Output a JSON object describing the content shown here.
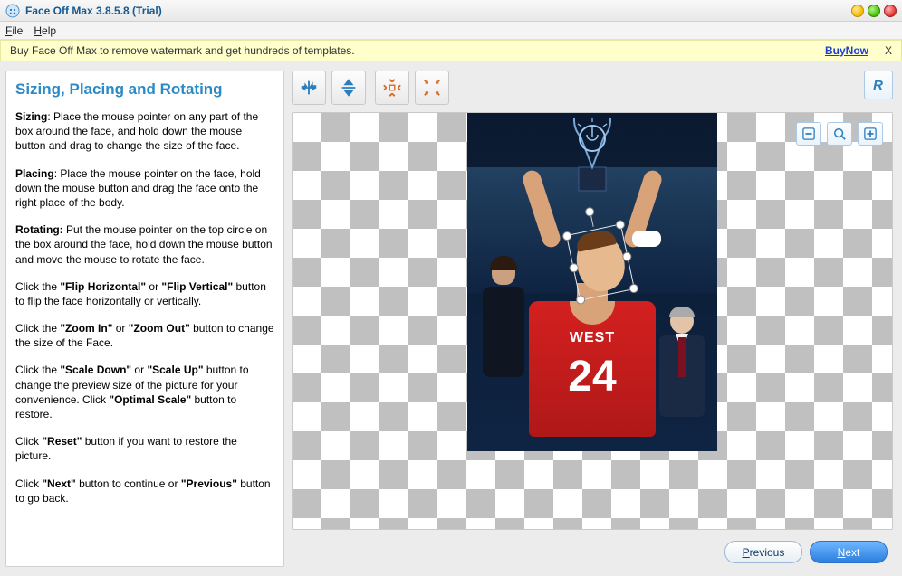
{
  "window": {
    "title": "Face Off Max  3.8.5.8  (Trial)"
  },
  "menu": {
    "file": "File",
    "help": "Help"
  },
  "trial": {
    "message": "Buy Face Off Max to remove watermark and get hundreds of templates.",
    "buy_label": "BuyNow",
    "close_label": "X"
  },
  "help_panel": {
    "title": "Sizing, Placing and Rotating",
    "sizing_label": "Sizing",
    "sizing_text": ": Place the mouse pointer on any part of the box around the face, and hold down the mouse button and drag to change the size of the face.",
    "placing_label": "Placing",
    "placing_text": ": Place the mouse pointer on the face, hold down the mouse button and drag the face onto the right place of the body.",
    "rotating_label": "Rotating:",
    "rotating_text": " Put the mouse pointer on the top circle on the box around the face, hold down the mouse button and move the mouse to rotate the face.",
    "flip_pre": "Click the ",
    "flip_h": "\"Flip Horizontal\"",
    "flip_or": " or ",
    "flip_v": "\"Flip Vertical\"",
    "flip_post": " button to flip the face horizontally or vertically.",
    "zoom_pre": "Click the ",
    "zoom_in": "\"Zoom In\"",
    "zoom_or": " or ",
    "zoom_out": "\"Zoom Out\"",
    "zoom_post": " button to change the size of the Face.",
    "scale_pre": "Click the ",
    "scale_down": "\"Scale Down\"",
    "scale_or": " or ",
    "scale_up": "\"Scale Up\"",
    "scale_mid": " button to change the preview size of the picture for your convenience. Click ",
    "scale_opt": "\"Optimal Scale\"",
    "scale_post": " button to restore.",
    "reset_pre": "Click ",
    "reset_b": "\"Reset\"",
    "reset_post": " button if you want to restore the picture.",
    "nav_pre": "Click ",
    "nav_next": "\"Next\"",
    "nav_mid": " button to continue or ",
    "nav_prev": "\"Previous\"",
    "nav_post": " button to go back."
  },
  "toolbar": {
    "flip_horizontal": "Flip Horizontal",
    "flip_vertical": "Flip Vertical",
    "zoom_in": "Zoom In",
    "zoom_out": "Zoom Out",
    "reset": "R"
  },
  "canvas": {
    "jersey_text": "WEST",
    "jersey_number": "24",
    "zoom_minus": "Scale Down",
    "zoom_opt": "Optimal Scale",
    "zoom_plus": "Scale Up"
  },
  "footer": {
    "previous": "Previous",
    "next": "Next"
  }
}
